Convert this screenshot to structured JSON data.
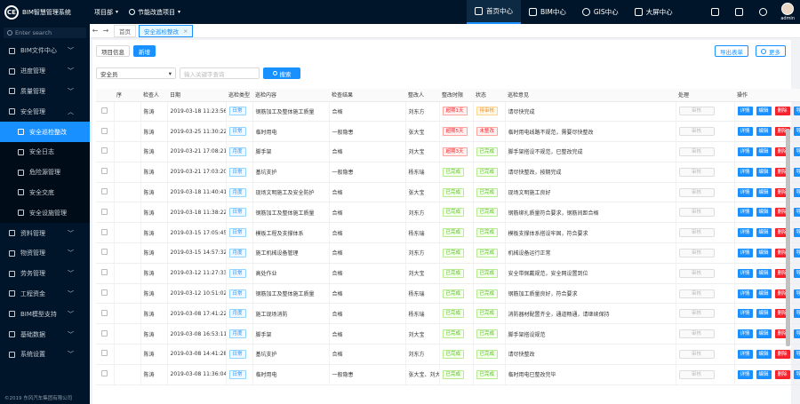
{
  "app": {
    "logo_mark": "CE",
    "title": "BIM智慧管理系统",
    "company_select": "项目部",
    "project_select": "节能改造项目"
  },
  "nav": [
    {
      "label": "首页中心",
      "active": true
    },
    {
      "label": "BIM中心",
      "active": false
    },
    {
      "label": "GIS中心",
      "active": false
    },
    {
      "label": "大屏中心",
      "active": false
    }
  ],
  "user": {
    "name": "admin"
  },
  "sidebar": {
    "search_placeholder": "Enter search",
    "items": [
      {
        "label": "BIM文件中心",
        "icon": "folder-icon",
        "type": "top"
      },
      {
        "label": "进度管理",
        "icon": "calendar-icon",
        "type": "top"
      },
      {
        "label": "质量管理",
        "icon": "quality-icon",
        "type": "top"
      },
      {
        "label": "安全管理",
        "icon": "flag-icon",
        "type": "top-open"
      },
      {
        "label": "安全巡检整改",
        "icon": "clipboard-icon",
        "type": "sub-active"
      },
      {
        "label": "安全日志",
        "icon": "log-icon",
        "type": "sub"
      },
      {
        "label": "危险源管理",
        "icon": "hammer-icon",
        "type": "sub"
      },
      {
        "label": "安全交底",
        "icon": "edu-icon",
        "type": "sub"
      },
      {
        "label": "安全设施管理",
        "icon": "shield-icon",
        "type": "sub"
      },
      {
        "label": "资料管理",
        "icon": "file-icon",
        "type": "top"
      },
      {
        "label": "物资管理",
        "icon": "box-icon",
        "type": "top"
      },
      {
        "label": "劳务管理",
        "icon": "people-icon",
        "type": "top"
      },
      {
        "label": "工程资金",
        "icon": "money-icon",
        "type": "top"
      },
      {
        "label": "BIM模型支持",
        "icon": "cube-icon",
        "type": "top"
      },
      {
        "label": "基础数据",
        "icon": "gear-icon",
        "type": "top"
      },
      {
        "label": "系统设置",
        "icon": "wrench-icon",
        "type": "top"
      }
    ],
    "copyright": "©2019 东风汽车集团有限公司"
  },
  "tabs": [
    {
      "label": "首页",
      "active": false
    },
    {
      "label": "安全巡检整改",
      "active": true
    }
  ],
  "toolbar": {
    "project_info": "项目信息",
    "add": "新增",
    "export": "导出表单",
    "more": "更多"
  },
  "filter": {
    "select": "安全员",
    "placeholder": "输入关键字查询",
    "search": "搜索"
  },
  "table": {
    "headers": [
      "序",
      "检查人",
      "日期",
      "巡检类型",
      "巡检内容",
      "检查结果",
      "整改人",
      "整改时限",
      "状态",
      "巡检意见",
      "处理",
      "操作"
    ],
    "review_label": "审核",
    "op_labels": [
      "详情",
      "编辑",
      "删除",
      "导出"
    ],
    "rows": [
      {
        "inspector": "陈涛",
        "date": "2019-03-18 11:23:56",
        "type": "日常",
        "type_color": "blue",
        "content": "钢筋加工及整体施工质量",
        "result": "合格",
        "assignee": "刘东方",
        "deadline": "超期1天",
        "deadline_color": "red",
        "status": "待审核",
        "status_color": "orange",
        "opinion": "请尽快完成"
      },
      {
        "inspector": "陈涛",
        "date": "2019-03-25 11:30:22",
        "type": "日常",
        "type_color": "blue",
        "content": "临时用电",
        "result": "一般隐患",
        "assignee": "张大宝",
        "deadline": "超期5天",
        "deadline_color": "red",
        "status": "未整改",
        "status_color": "red",
        "opinion": "临时用电线路不规范，需要尽快整改"
      },
      {
        "inspector": "陈涛",
        "date": "2019-03-21 17:08:21",
        "type": "月度",
        "type_color": "blue",
        "content": "脚手架",
        "result": "合格",
        "assignee": "刘大宝",
        "deadline": "超期3天",
        "deadline_color": "red",
        "status": "已完成",
        "status_color": "green",
        "opinion": "脚手架搭设不规范，已整改完成"
      },
      {
        "inspector": "陈涛",
        "date": "2019-03-21 17:03:20",
        "type": "日常",
        "type_color": "blue",
        "content": "基坑支护",
        "result": "一般隐患",
        "assignee": "杨东瑞",
        "deadline": "已完成",
        "deadline_color": "green",
        "status": "已完成",
        "status_color": "green",
        "opinion": "请尽快整改，按期完成"
      },
      {
        "inspector": "陈涛",
        "date": "2019-03-18 11:40:41",
        "type": "月度",
        "type_color": "blue",
        "content": "现场文明施工及安全防护",
        "result": "合格",
        "assignee": "张大宝",
        "deadline": "已完成",
        "deadline_color": "green",
        "status": "已完成",
        "status_color": "green",
        "opinion": "现场文明施工良好"
      },
      {
        "inspector": "陈涛",
        "date": "2019-03-18 11:38:22",
        "type": "日常",
        "type_color": "blue",
        "content": "钢筋加工及整体施工质量",
        "result": "合格",
        "assignee": "刘东方",
        "deadline": "已完成",
        "deadline_color": "green",
        "status": "已完成",
        "status_color": "green",
        "opinion": "钢筋绑扎质量符合要求，钢筋间距合格"
      },
      {
        "inspector": "陈涛",
        "date": "2019-03-15 17:05:45",
        "type": "日常",
        "type_color": "blue",
        "content": "模板工程及支撑体系",
        "result": "合格",
        "assignee": "杨东瑞",
        "deadline": "已完成",
        "deadline_color": "green",
        "status": "已完成",
        "status_color": "green",
        "opinion": "模板支撑体系搭设牢固，符合要求"
      },
      {
        "inspector": "陈涛",
        "date": "2019-03-15 14:57:32",
        "type": "月度",
        "type_color": "blue",
        "content": "施工机械设备管理",
        "result": "合格",
        "assignee": "刘东方",
        "deadline": "已完成",
        "deadline_color": "green",
        "status": "已完成",
        "status_color": "green",
        "opinion": "机械设备运行正常"
      },
      {
        "inspector": "陈涛",
        "date": "2019-03-12 11:27:33",
        "type": "日常",
        "type_color": "blue",
        "content": "高处作业",
        "result": "合格",
        "assignee": "刘大宝",
        "deadline": "已完成",
        "deadline_color": "green",
        "status": "已完成",
        "status_color": "green",
        "opinion": "安全带佩戴规范，安全网设置到位"
      },
      {
        "inspector": "陈涛",
        "date": "2019-03-12 10:51:02",
        "type": "日常",
        "type_color": "blue",
        "content": "钢筋加工及整体施工质量",
        "result": "合格",
        "assignee": "杨东瑞",
        "deadline": "已完成",
        "deadline_color": "green",
        "status": "已完成",
        "status_color": "green",
        "opinion": "钢筋加工质量良好，符合要求"
      },
      {
        "inspector": "陈涛",
        "date": "2019-03-08 17:41:22",
        "type": "月度",
        "type_color": "blue",
        "content": "施工现场消防",
        "result": "合格",
        "assignee": "杨东瑞",
        "deadline": "已完成",
        "deadline_color": "green",
        "status": "已完成",
        "status_color": "green",
        "opinion": "消防器材配置齐全，通道畅通，请继续保持"
      },
      {
        "inspector": "陈涛",
        "date": "2019-03-08 16:53:11",
        "type": "月度",
        "type_color": "blue",
        "content": "脚手架",
        "result": "合格",
        "assignee": "刘大宝",
        "deadline": "已完成",
        "deadline_color": "green",
        "status": "已完成",
        "status_color": "green",
        "opinion": "脚手架搭设规范"
      },
      {
        "inspector": "陈涛",
        "date": "2019-03-08 14:41:28",
        "type": "日常",
        "type_color": "blue",
        "content": "基坑支护",
        "result": "合格",
        "assignee": "刘东方",
        "deadline": "已完成",
        "deadline_color": "green",
        "status": "已完成",
        "status_color": "green",
        "opinion": "请尽快整改"
      },
      {
        "inspector": "陈涛",
        "date": "2019-03-08 11:36:04",
        "type": "日常",
        "type_color": "blue",
        "content": "临时用电",
        "result": "一般隐患",
        "assignee": "张大宝、刘大宝",
        "deadline": "已完成",
        "deadline_color": "green",
        "status": "已完成",
        "status_color": "green",
        "opinion": "临时用电已整改完毕"
      }
    ]
  },
  "colors": {
    "primary": "#1890ff",
    "sidebar_bg": "#001529",
    "danger": "#f5222d",
    "success": "#52c41a"
  }
}
